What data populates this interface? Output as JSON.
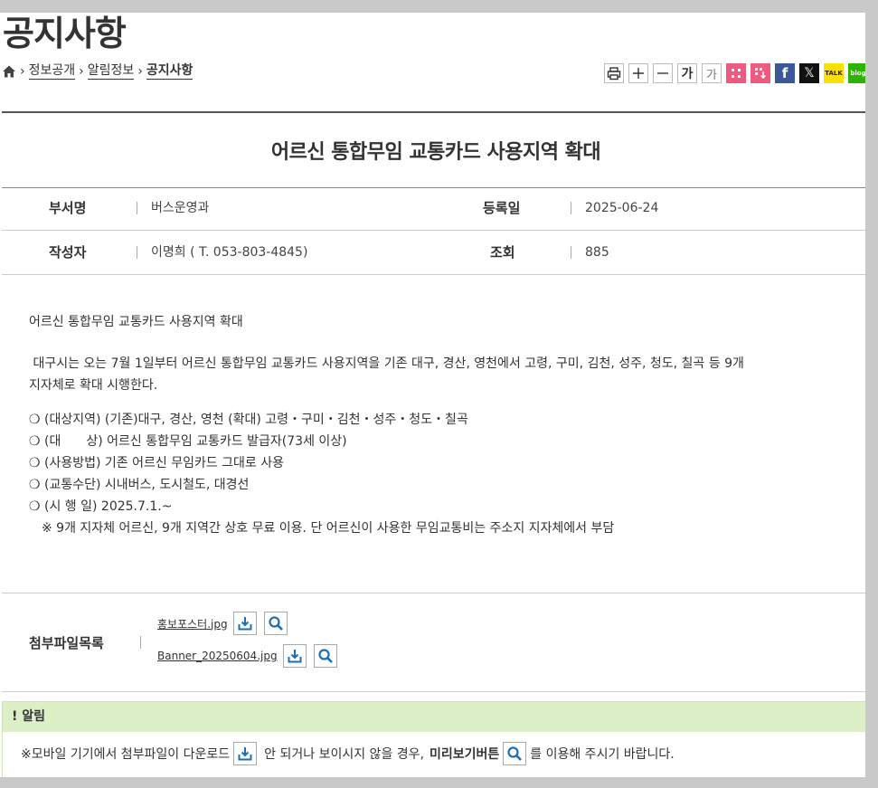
{
  "page": {
    "title": "공지사항"
  },
  "breadcrumb": {
    "items": [
      "정보공개",
      "알림정보",
      "공지사항"
    ]
  },
  "tools": {
    "font_large": "가",
    "font_small": "가",
    "facebook": "f",
    "x": "𝕏",
    "kakao": "TALK",
    "blog": "blog"
  },
  "post": {
    "title": "어르신 통합무임 교통카드 사용지역 확대",
    "department_label": "부서명",
    "department": "버스운영과",
    "date_label": "등록일",
    "date": "2025-06-24",
    "author_label": "작성자",
    "author": "이명희 ( T. 053-803-4845)",
    "views_label": "조회",
    "views": "885"
  },
  "content": {
    "heading": "어르신 통합무임 교통카드 사용지역 확대",
    "para_line1": " 대구시는 오는 7월 1일부터 어르신 통합무임 교통카드 사용지역을 기존 대구, 경산, 영천에서 고령, 구미, 김천, 성주, 청도, 칠곡 등 9개",
    "para_line2": "지자체로 확대 시행한다.",
    "bullets": [
      "❍ (대상지역) (기존)대구, 경산, 영천 (확대) 고령・구미・김천・성주・청도・칠곡",
      "❍ (대　　상) 어르신 통합무임 교통카드 발급자(73세 이상)",
      "❍ (사용방법) 기존 어르신 무임카드 그대로 사용",
      "❍ (교통수단) 시내버스, 도시철도, 대경선",
      "❍ (시 행 일) 2025.7.1.~"
    ],
    "note": "※ 9개 지자체 어르신, 9개 지역간 상호 무료 이용. 단 어르신이 사용한 무임교통비는 주소지 지자체에서 부담"
  },
  "attachments": {
    "label": "첨부파일목록",
    "files": [
      "홍보포스터.jpg",
      "Banner_20250604.jpg"
    ]
  },
  "notice": {
    "title": "! 알림",
    "text_before": "※모바일 기기에서 첨부파일이 다운로드",
    "text_middle": "안 되거나 보이시지 않을 경우,",
    "preview_bold": "미리보기버튼",
    "text_after": "를 이용해 주시기 바랍니다."
  },
  "colors": {
    "notice_header_bg": "#dcefc6",
    "icon_blue": "#1a6fb5",
    "facebook": "#3b5998",
    "kakao": "#fae100",
    "blog": "#2db400",
    "share_pink": "#f05a7e"
  }
}
